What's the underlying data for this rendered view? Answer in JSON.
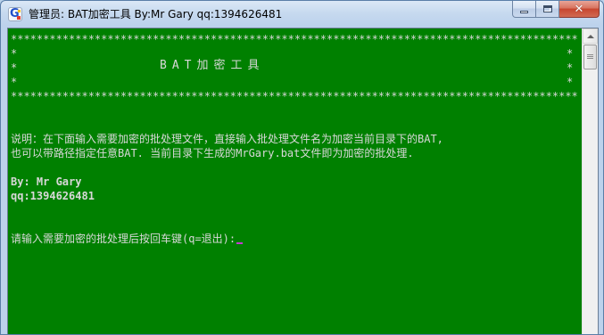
{
  "window": {
    "title": "管理员:  BAT加密工具 By:Mr Gary qq:1394626481",
    "icon": "app-g-icon"
  },
  "caption_buttons": {
    "minimize": "minimize-icon",
    "maximize": "maximize-icon",
    "close": "close-icon",
    "close_glyph": "✕"
  },
  "console": {
    "background": "#008000",
    "text_color": "#d8d8d8",
    "border_stars": "****************************************************************************************",
    "side_star": "*",
    "banner_title": "BAT加密工具",
    "desc_line1": "说明：在下面输入需要加密的批处理文件，直接输入批处理文件名为加密当前目录下的BAT,",
    "desc_line2": "也可以带路径指定任意BAT. 当前目录下生成的MrGary.bat文件即为加密的批处理.",
    "author": "By: Mr Gary",
    "qq": "qq:1394626481",
    "prompt": "请输入需要加密的批处理后按回车键(q=退出):",
    "cursor_color": "#c33bd1"
  },
  "scrollbar": {
    "up_arrow": "scroll-up-arrow-icon"
  }
}
